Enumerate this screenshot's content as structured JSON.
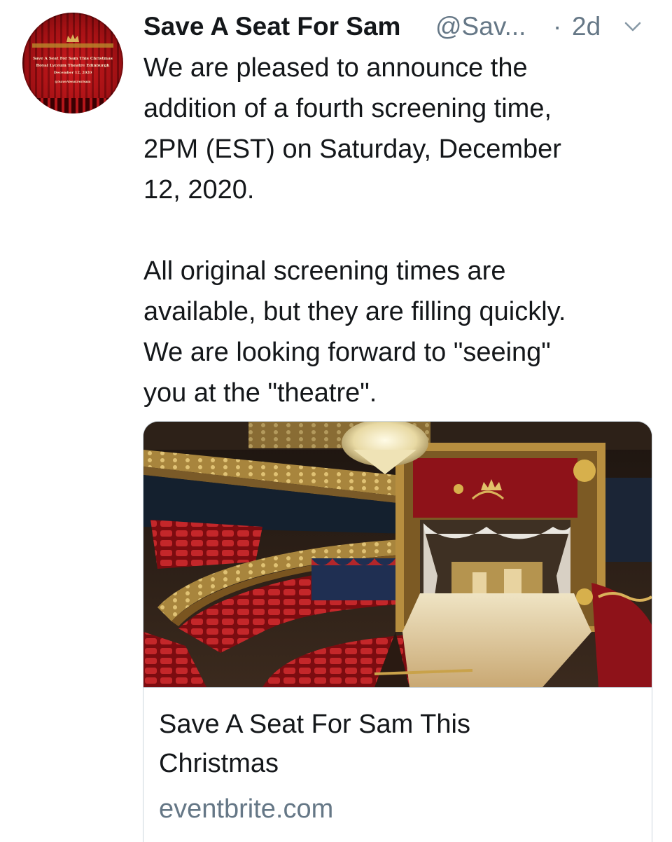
{
  "avatar": {
    "line1": "Save A Seat For Sam This Christmas",
    "line2": "Royal Lyceum Theatre Edinburgh",
    "line3": "December 12, 2020",
    "line4": "@SaveASeatForSam",
    "icon": "crown-icon"
  },
  "header": {
    "display_name": "Save A Seat For Sam",
    "handle": "@Sav...",
    "separator": "·",
    "time": "2d",
    "menu_icon": "chevron-down-icon"
  },
  "tweet": {
    "text": "We are pleased to announce the\naddition of a fourth screening time,\n2PM (EST) on Saturday, December\n12, 2020.\n\nAll original screening times are\navailable, but they are filling quickly.\nWe are looking forward to \"seeing\"\nyou at the \"theatre\"."
  },
  "card": {
    "title": "Save A Seat For Sam This\nChristmas",
    "domain": "eventbrite.com"
  },
  "colors": {
    "text": "#14171a",
    "secondary": "#657786",
    "border": "#ccd6dd",
    "curtain_red": "#8e1219",
    "gold": "#c9a24a"
  }
}
